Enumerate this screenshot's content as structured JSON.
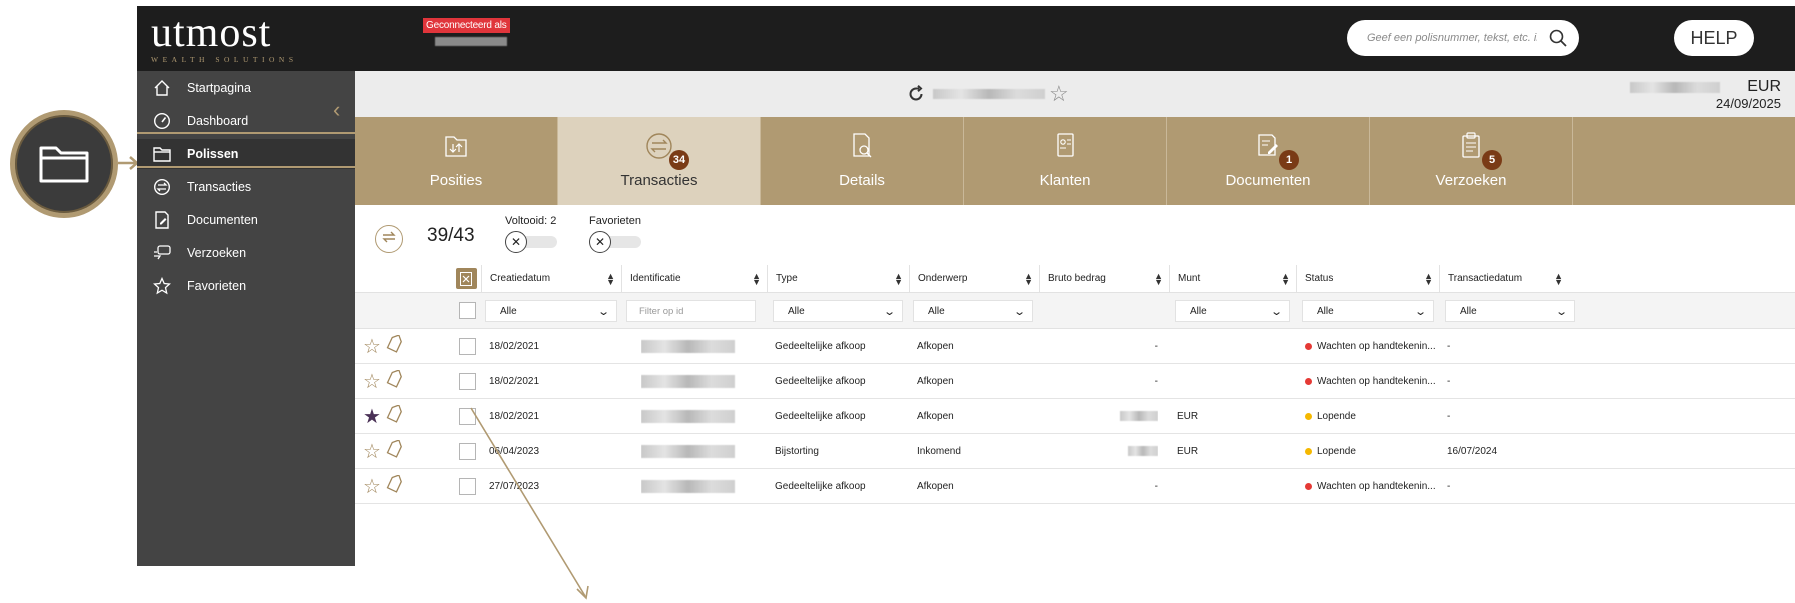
{
  "app": {
    "logo_text": "utmost",
    "logo_subtitle": "WEALTH SOLUTIONS",
    "connected_label": "Geconnecteerd als",
    "search_placeholder": "Geef een polisnummer, tekst, etc. in",
    "help_label": "HELP"
  },
  "sidebar": {
    "items": [
      {
        "label": "Startpagina",
        "icon": "home-icon"
      },
      {
        "label": "Dashboard",
        "icon": "gauge-icon"
      },
      {
        "label": "Polissen",
        "icon": "folder-icon"
      },
      {
        "label": "Transacties",
        "icon": "exchange-icon"
      },
      {
        "label": "Documenten",
        "icon": "document-edit-icon"
      },
      {
        "label": "Verzoeken",
        "icon": "chat-icon"
      },
      {
        "label": "Favorieten",
        "icon": "star-icon"
      }
    ],
    "active": "Polissen"
  },
  "policy_header": {
    "currency": "EUR",
    "date": "24/09/2025"
  },
  "tiles": [
    {
      "label": "Posities",
      "icon": "folder-transfer-icon",
      "badge": ""
    },
    {
      "label": "Transacties",
      "icon": "exchange-icon",
      "badge": "34"
    },
    {
      "label": "Details",
      "icon": "document-search-icon",
      "badge": ""
    },
    {
      "label": "Klanten",
      "icon": "contact-card-icon",
      "badge": ""
    },
    {
      "label": "Documenten",
      "icon": "document-edit-icon",
      "badge": "1"
    },
    {
      "label": "Verzoeken",
      "icon": "clipboard-icon",
      "badge": "5"
    }
  ],
  "toolbar": {
    "counter": "39/43",
    "filter_completed": "Voltooid: 2",
    "filter_favorites": "Favorieten"
  },
  "table": {
    "columns": [
      "Creatiedatum",
      "Identificatie",
      "Type",
      "Onderwerp",
      "Bruto bedrag",
      "Munt",
      "Status",
      "Transactiedatum"
    ],
    "filters": {
      "creatiedatum": "Alle",
      "identificatie_placeholder": "Filter op id",
      "type": "Alle",
      "onderwerp": "Alle",
      "munt": "Alle",
      "status": "Alle",
      "transactiedatum": "Alle"
    },
    "rows": [
      {
        "favorite": false,
        "date": "18/02/2021",
        "type": "Gedeeltelijke afkoop",
        "subject": "Afkopen",
        "amount": "-",
        "currency": "",
        "status": "Wachten op handtekenin...",
        "status_color": "#e53935",
        "tx_date": "-"
      },
      {
        "favorite": false,
        "date": "18/02/2021",
        "type": "Gedeeltelijke afkoop",
        "subject": "Afkopen",
        "amount": "-",
        "currency": "",
        "status": "Wachten op handtekenin...",
        "status_color": "#e53935",
        "tx_date": "-"
      },
      {
        "favorite": true,
        "date": "18/02/2021",
        "type": "Gedeeltelijke afkoop",
        "subject": "Afkopen",
        "amount": "",
        "currency": "EUR",
        "status": "Lopende",
        "status_color": "#f5b800",
        "tx_date": "-"
      },
      {
        "favorite": false,
        "date": "06/04/2023",
        "type": "Bijstorting",
        "subject": "Inkomend",
        "amount": "",
        "currency": "EUR",
        "status": "Lopende",
        "status_color": "#f5b800",
        "tx_date": "16/07/2024"
      },
      {
        "favorite": false,
        "date": "27/07/2023",
        "type": "Gedeeltelijke afkoop",
        "subject": "Afkopen",
        "amount": "-",
        "currency": "",
        "status": "Wachten op handtekenin...",
        "status_color": "#e53935",
        "tx_date": "-"
      }
    ]
  },
  "colors": {
    "gold": "#b09a72",
    "dark": "#1d1d1d",
    "sidebar": "#444444",
    "badge": "#7a3b16"
  }
}
